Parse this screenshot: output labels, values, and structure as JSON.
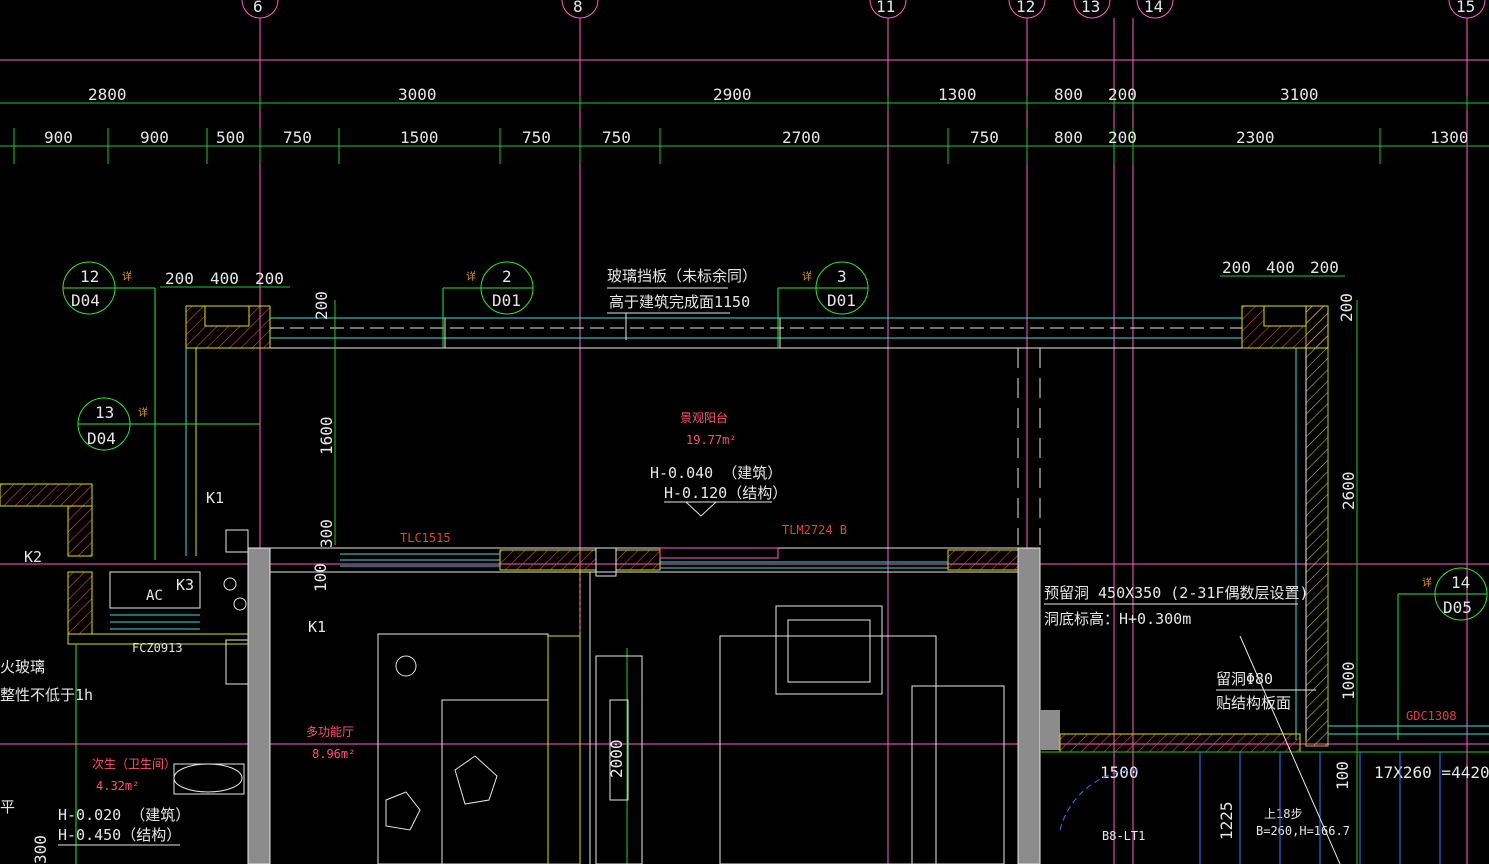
{
  "axis_labels": [
    "6",
    "8",
    "11",
    "12",
    "13",
    "14",
    "15"
  ],
  "dims_top": [
    "2800",
    "3000",
    "2900",
    "1300",
    "800",
    "200",
    "3100"
  ],
  "dims_bottom": [
    "900",
    "900",
    "500",
    "750",
    "1500",
    "750",
    "750",
    "2700",
    "750",
    "800",
    "200",
    "2300",
    "1300"
  ],
  "callouts": [
    {
      "num": "12",
      "ref": "D04"
    },
    {
      "num": "13",
      "ref": "D04"
    },
    {
      "num": "2",
      "ref": "D01"
    },
    {
      "num": "3",
      "ref": "D01"
    },
    {
      "num": "14",
      "ref": "D05"
    }
  ],
  "detail_mark": "详",
  "left_wall_dims": [
    "200",
    "400",
    "200"
  ],
  "right_wall_dims": [
    "200",
    "400",
    "200"
  ],
  "vertical_dims": [
    "200",
    "1600",
    "300",
    "100",
    "200",
    "2600",
    "1000",
    "2000",
    "100",
    "1225"
  ],
  "notes": {
    "glass_line1": "玻璃挡板（未标余同）",
    "glass_line2": "高于建筑完成面1150",
    "balcony_name": "景观阳台",
    "balcony_area": "19.77m²",
    "balcony_h1": "H-0.040 （建筑）",
    "balcony_h2": "H-0.120（结构）",
    "window_tlc": "TLC1515",
    "window_tlm": "TLM2724 B",
    "hole_line1": "预留洞 450X350 (2-31F偶数层设置)",
    "hole_line2": "洞底标高：H+0.300m",
    "hole80_line1": "留洞Φ80",
    "hole80_line2": "贴结构板面",
    "gdc": "GDC1308",
    "stair": "17X260 =4420",
    "stair_up": "上18步",
    "stair_b": "B=260,H=166.7",
    "b8": "B8-LT1",
    "dim1500": "1500",
    "k1a": "K1",
    "k1b": "K1",
    "k2": "K2",
    "k3": "K3",
    "ac": "AC",
    "fc": "FCZ0913",
    "fire_glass": "火玻璃",
    "fire_rating": "整性不低于1h",
    "bath_name": "次生（卫生间）",
    "bath_area": "4.32m²",
    "bath_h1": "H-0.020 （建筑）",
    "bath_h2": "H-0.450（结构）",
    "room_name": "多功能厅",
    "room_area": "8.96m²",
    "ping": "平",
    "dim300": "300"
  }
}
